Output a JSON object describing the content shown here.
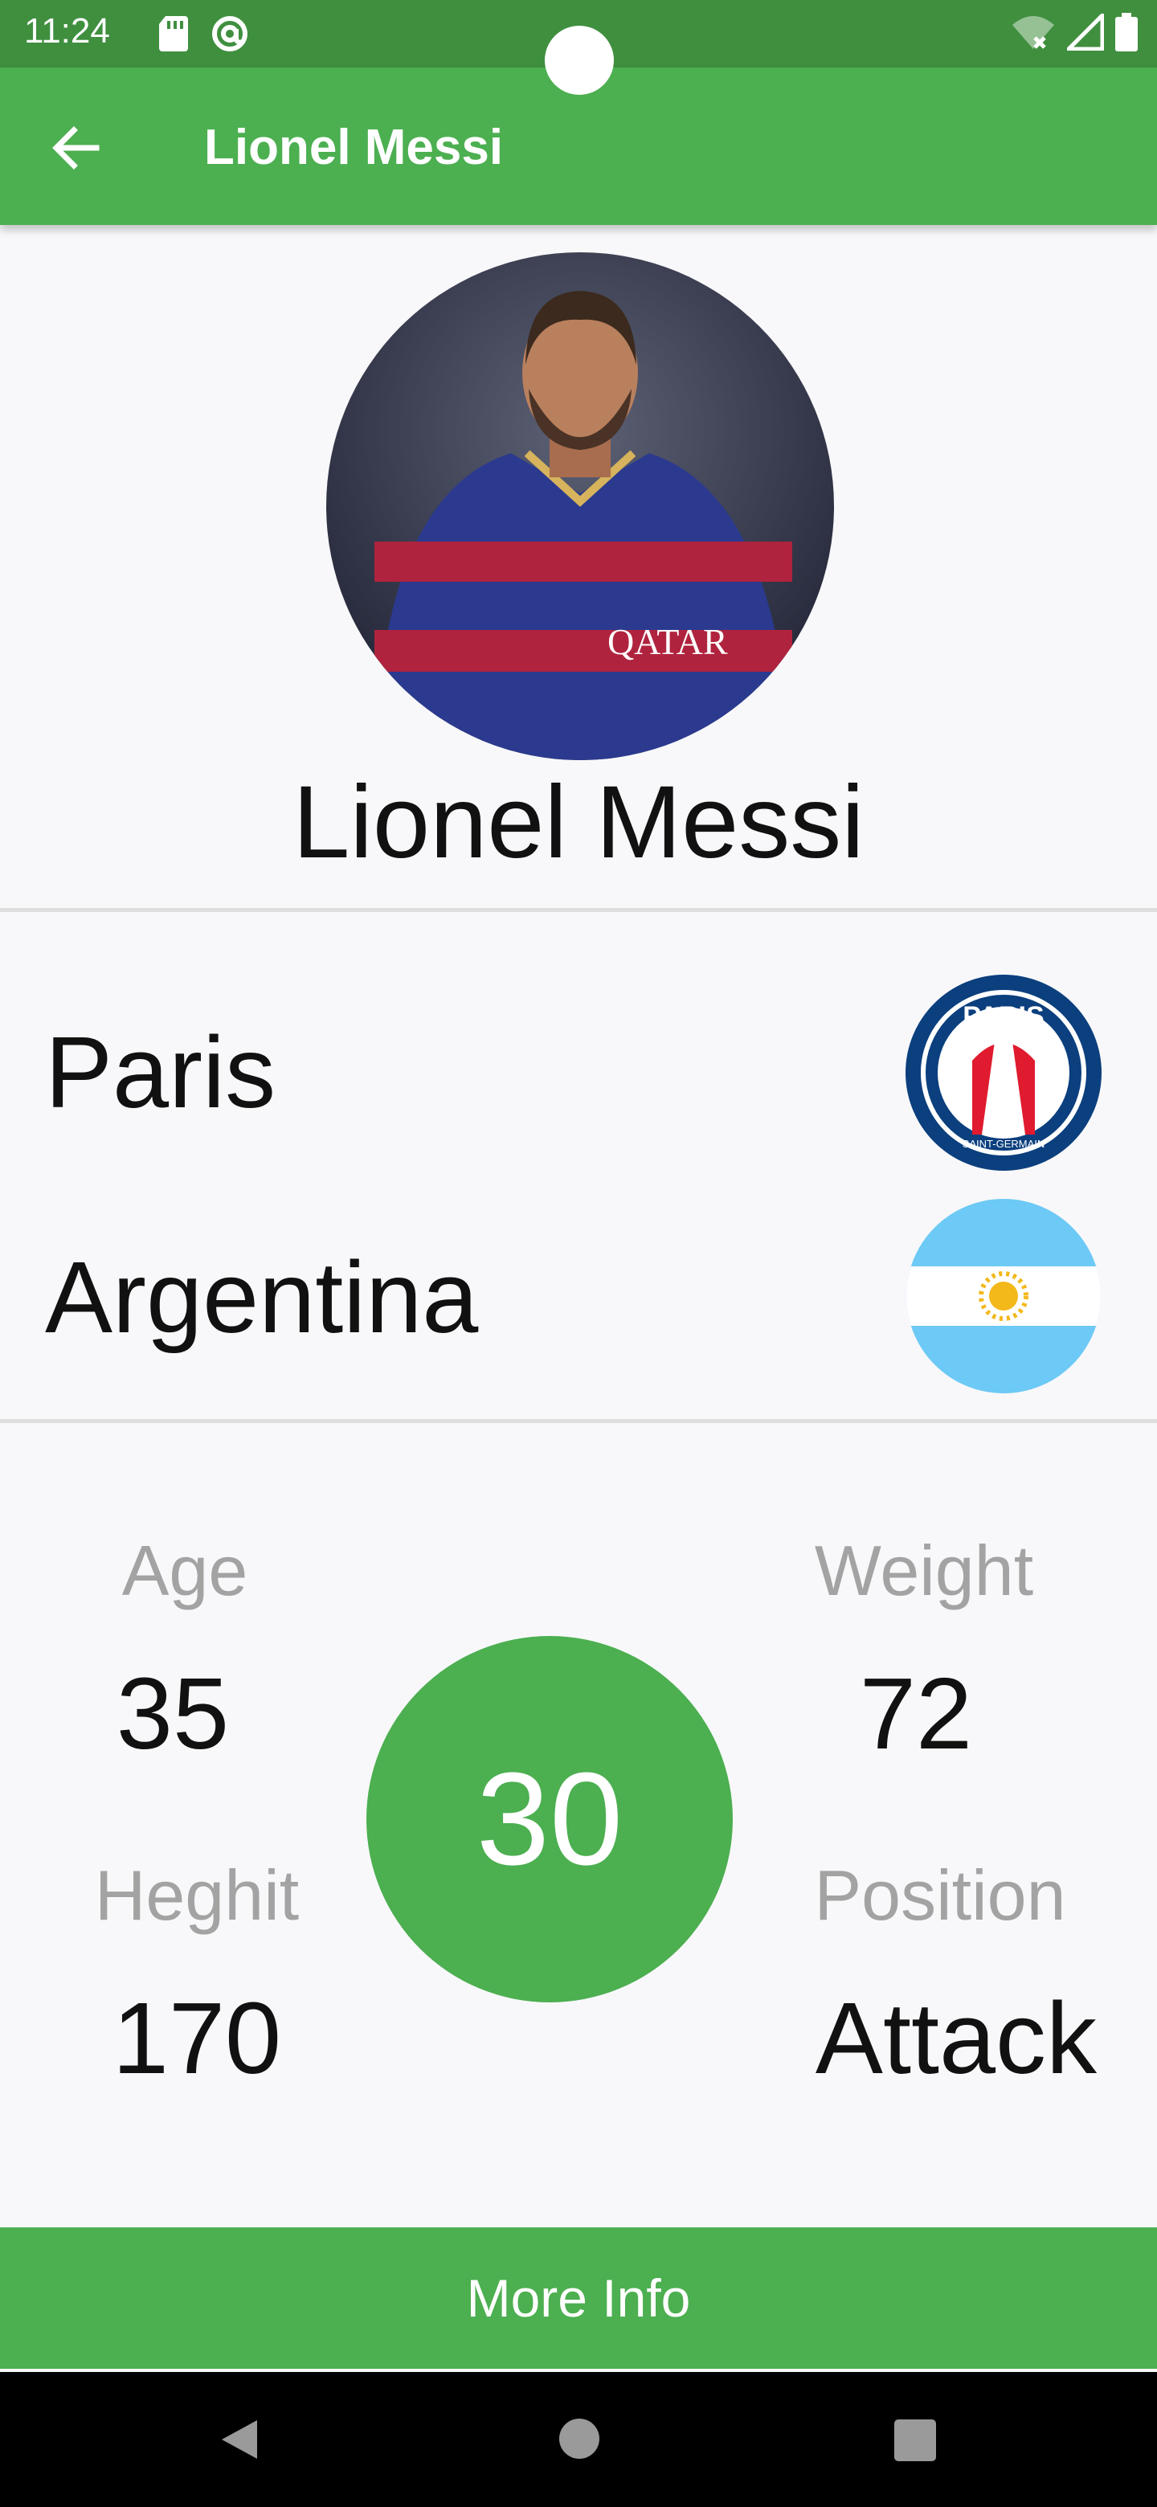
{
  "status_bar": {
    "time": "11:24",
    "left_icons": [
      "sd-card-icon",
      "at-sign-icon"
    ],
    "right_icons": [
      "wifi-icon",
      "signal-icon",
      "battery-icon"
    ]
  },
  "app_bar": {
    "back_icon": "arrow-left-icon",
    "title": "Lionel Messi",
    "color": "#4caf50"
  },
  "profile": {
    "name": "Lionel Messi",
    "photo": "player-photo"
  },
  "affiliation": {
    "club": {
      "label": "Paris",
      "logo": "psg-logo",
      "logo_text_top": "PARIS",
      "logo_text_bottom": "SAINT-GERMAIN"
    },
    "nation": {
      "label": "Argentina",
      "flag": "argentina-flag"
    }
  },
  "stats": {
    "age": {
      "label": "Age",
      "value": "35"
    },
    "weight": {
      "label": "Weight",
      "value": "72"
    },
    "height": {
      "label": "Heghit",
      "value": "170"
    },
    "position": {
      "label": "Position",
      "value": "Attack"
    },
    "rating": "30"
  },
  "footer": {
    "more_info_label": "More Info"
  },
  "nav_bar": {
    "icons": [
      "back-triangle-icon",
      "home-circle-icon",
      "recents-square-icon"
    ]
  }
}
